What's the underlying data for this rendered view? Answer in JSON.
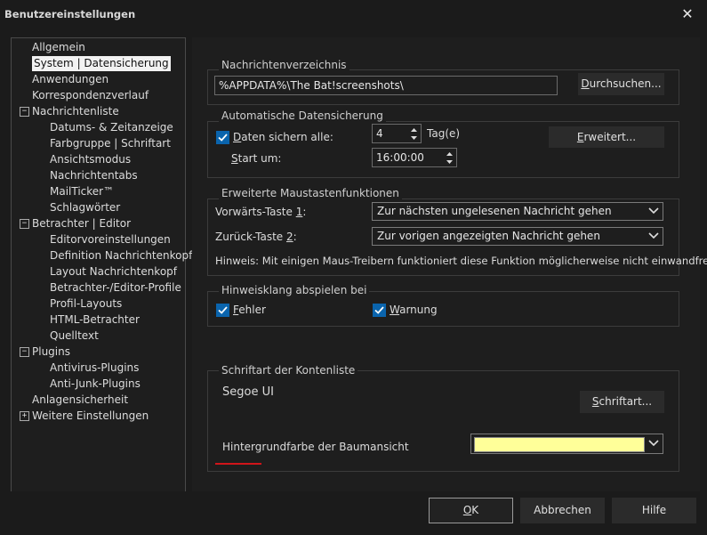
{
  "window": {
    "title": "Benutzereinstellungen",
    "close_glyph": "✕"
  },
  "tree": [
    {
      "label": "Allgemein",
      "level": 1
    },
    {
      "label": "System | Datensicherung",
      "level": 1,
      "selected": true
    },
    {
      "label": "Anwendungen",
      "level": 1
    },
    {
      "label": "Korrespondenzverlauf",
      "level": 1
    },
    {
      "label": "Nachrichtenliste",
      "level": 1,
      "expander": "−"
    },
    {
      "label": "Datums- & Zeitanzeige",
      "level": 2
    },
    {
      "label": "Farbgruppe | Schriftart",
      "level": 2
    },
    {
      "label": "Ansichtsmodus",
      "level": 2
    },
    {
      "label": "Nachrichtentabs",
      "level": 2
    },
    {
      "label": "MailTicker™",
      "level": 2
    },
    {
      "label": "Schlagwörter",
      "level": 2
    },
    {
      "label": "Betrachter | Editor",
      "level": 1,
      "expander": "−"
    },
    {
      "label": "Editorvoreinstellungen",
      "level": 2
    },
    {
      "label": "Definition Nachrichtenkopf",
      "level": 2
    },
    {
      "label": "Layout Nachrichtenkopf",
      "level": 2
    },
    {
      "label": "Betrachter-/Editor-Profile",
      "level": 2
    },
    {
      "label": "Profil-Layouts",
      "level": 2
    },
    {
      "label": "HTML-Betrachter",
      "level": 2
    },
    {
      "label": "Quelltext",
      "level": 2
    },
    {
      "label": "Plugins",
      "level": 1,
      "expander": "−"
    },
    {
      "label": "Antivirus-Plugins",
      "level": 2
    },
    {
      "label": "Anti-Junk-Plugins",
      "level": 2
    },
    {
      "label": "Anlagensicherheit",
      "level": 1
    },
    {
      "label": "Weitere Einstellungen",
      "level": 1,
      "expander": "+"
    }
  ],
  "msgdir": {
    "legend": "Nachrichtenverzeichnis",
    "path": "%APPDATA%\\The Bat!screenshots\\",
    "browse_label": "Durchsuchen..."
  },
  "backup": {
    "legend": "Automatische Datensicherung",
    "save_every_label": "Daten sichern alle:",
    "save_every_checked": true,
    "days_value": "4",
    "days_unit": "Tag(e)",
    "start_label": "Start um:",
    "start_time": "16:00:00",
    "advanced_label": "Erweitert..."
  },
  "mouse": {
    "legend": "Erweiterte Maustastenfunktionen",
    "forward_label": "Vorwärts-Taste 1:",
    "forward_value": "Zur nächsten ungelesenen Nachricht gehen",
    "back_label": "Zurück-Taste 2:",
    "back_value": "Zur vorigen angezeigten Nachricht gehen",
    "hint": "Hinweis: Mit einigen Maus-Treibern funktioniert diese Funktion möglicherweise nicht einwandfrei."
  },
  "sound": {
    "legend": "Hinweisklang abspielen bei",
    "error_label": "Fehler",
    "error_checked": true,
    "warning_label": "Warnung",
    "warning_checked": true
  },
  "font": {
    "legend": "Schriftart der Kontenliste",
    "current": "Segoe UI",
    "button_label": "Schriftart...",
    "bg_label": "Hintergrundfarbe der Baumansicht",
    "bg_color": "#ffff99"
  },
  "footer": {
    "ok": "OK",
    "cancel": "Abbrechen",
    "help": "Hilfe"
  },
  "colors": {
    "accent": "#0a64ad",
    "annotation_line": "#d0151a"
  }
}
